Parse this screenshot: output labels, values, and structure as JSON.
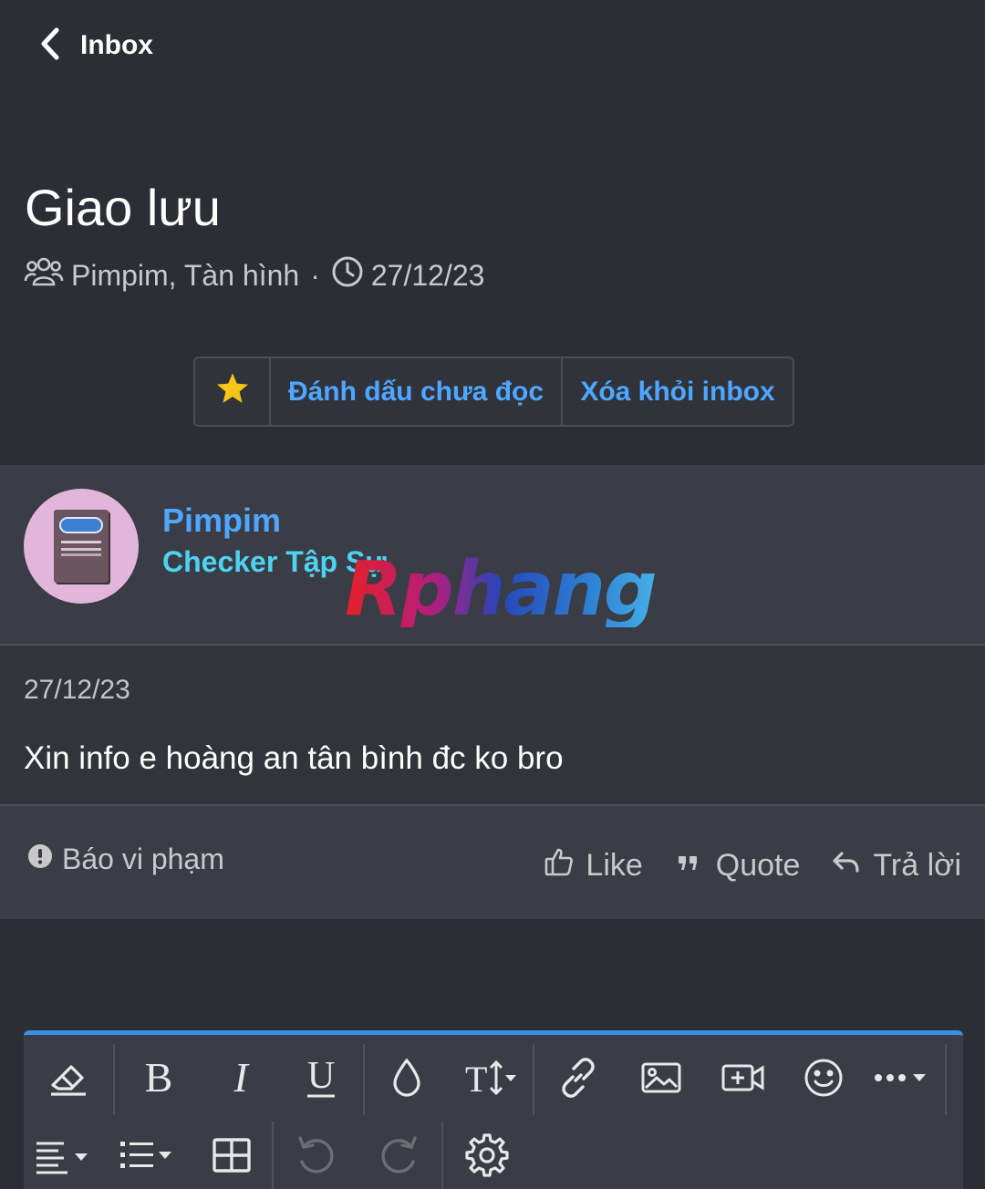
{
  "nav": {
    "back_label": "Inbox"
  },
  "conversation": {
    "title": "Giao lưu",
    "participants": "Pimpim, Tàn hình",
    "separator": "·",
    "date": "27/12/23"
  },
  "actions": {
    "star_icon": "star-icon",
    "mark_unread": "Đánh dấu chưa đọc",
    "remove_inbox": "Xóa khỏi inbox"
  },
  "message": {
    "author": "Pimpim",
    "author_title": "Checker Tập Sự",
    "watermark": "Rphang",
    "date": "27/12/23",
    "text": "Xin info e hoàng an tân bình đc ko bro",
    "report": "Báo vi phạm",
    "like": "Like",
    "quote": "Quote",
    "reply": "Trả lời"
  },
  "colors": {
    "background": "#2c2e35",
    "accent": "#4ea6ff",
    "author_title": "#4fd2f2",
    "star": "#f5c518"
  }
}
